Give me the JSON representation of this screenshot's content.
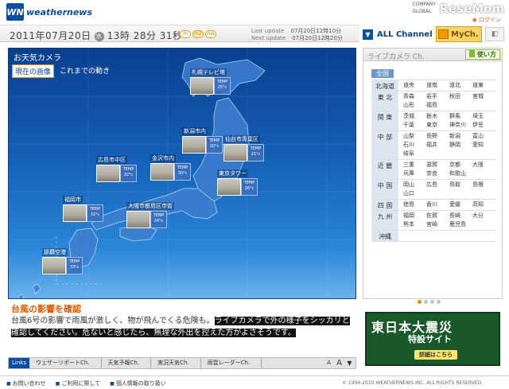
{
  "header": {
    "logo_mark": "WN",
    "logo_text": "weathernews",
    "top_links": [
      "COMPANY",
      "GLOBAL"
    ],
    "watermark": "ReseMom",
    "login": "ログイン"
  },
  "datebar": {
    "date": "2011年07月20日",
    "weekday": "水",
    "time": "13時 28分 31秒",
    "sizes": [
      "m",
      "m2",
      "ma"
    ],
    "active_size": "m2",
    "last_update_label": "Last update",
    "last_update_value": "07月20日12時10分",
    "next_update_label": "Next update",
    "next_update_value": "07月20日12時20分"
  },
  "tabs": {
    "all_channel": "ALL Channel",
    "my_ch": "MyCh."
  },
  "camera": {
    "title": "お天気カメラ",
    "tab_current": "現在の画像",
    "tab_history": "これまでの動き",
    "temp_label": "TEMP",
    "cams": [
      {
        "name": "札幌テレビ塔",
        "temp": "25°c"
      },
      {
        "name": "新潟市内",
        "temp": "30°c"
      },
      {
        "name": "仙台市青葉区",
        "temp": "21°c"
      },
      {
        "name": "広島市中区",
        "temp": "32°c"
      },
      {
        "name": "金沢市内",
        "temp": "30°c"
      },
      {
        "name": "東京タワー",
        "temp": "26°c"
      },
      {
        "name": "福岡市",
        "temp": "31°c"
      },
      {
        "name": "大阪市都島区市街",
        "temp": "24°c"
      },
      {
        "name": "那覇空港",
        "temp": "33°c"
      }
    ]
  },
  "news": {
    "title": "台風の影響を確認",
    "body_plain": "台風6号の影響で雨風が激しく、物が飛んでくる危険も。",
    "body_highlight": "ライブカメラで外の様子をシッカリと確認してください。危ないと感じたら、無理な外出を控えた方がよさそうです。"
  },
  "links_bar": {
    "label": "Links",
    "items": [
      "ウェザーリポートCh.",
      "天気予報Ch.",
      "実況天気Ch.",
      "雨雲レーダーCh."
    ],
    "ctrl_small": "A",
    "ctrl_large": "A"
  },
  "live_panel": {
    "title": "ライブカメラ Ch.",
    "howto": "使い方",
    "all": "全国",
    "regions": [
      {
        "name": "北海道",
        "cities": [
          "道央",
          "道南",
          "道北",
          "道東"
        ]
      },
      {
        "name": "東 北",
        "cities": [
          "青森",
          "岩手",
          "秋田",
          "宮城",
          "山形",
          "福島"
        ]
      },
      {
        "name": "関 東",
        "cities": [
          "茨城",
          "栃木",
          "群馬",
          "埼玉",
          "千葉",
          "東京",
          "神奈川",
          "伊豆"
        ]
      },
      {
        "name": "中 部",
        "cities": [
          "山梨",
          "長野",
          "新潟",
          "富山",
          "石川",
          "福井",
          "静岡",
          "愛知",
          "岐阜"
        ]
      },
      {
        "name": "近 畿",
        "cities": [
          "三重",
          "滋賀",
          "京都",
          "大阪",
          "兵庫",
          "奈良",
          "和歌山"
        ]
      },
      {
        "name": "中 国",
        "cities": [
          "岡山",
          "広島",
          "鳥取",
          "島根",
          "山口"
        ]
      },
      {
        "name": "四 国",
        "cities": [
          "徳島",
          "香川",
          "愛媛",
          "高知"
        ]
      },
      {
        "name": "九 州",
        "cities": [
          "福岡",
          "佐賀",
          "長崎",
          "大分",
          "熊本",
          "宮崎",
          "鹿児島"
        ]
      },
      {
        "name": "沖縄",
        "cities": []
      }
    ]
  },
  "banner": {
    "line1": "東日本大震災",
    "line2": "特設サイト",
    "button": "詳細はこちら"
  },
  "footer": {
    "links": [
      "お問い合わせ",
      "ご利用に際して",
      "個人情報の取り扱い"
    ],
    "copyright": "© 1996-2010 WEATHERNEWS INC. ALL RIGHTS RESERVED."
  }
}
